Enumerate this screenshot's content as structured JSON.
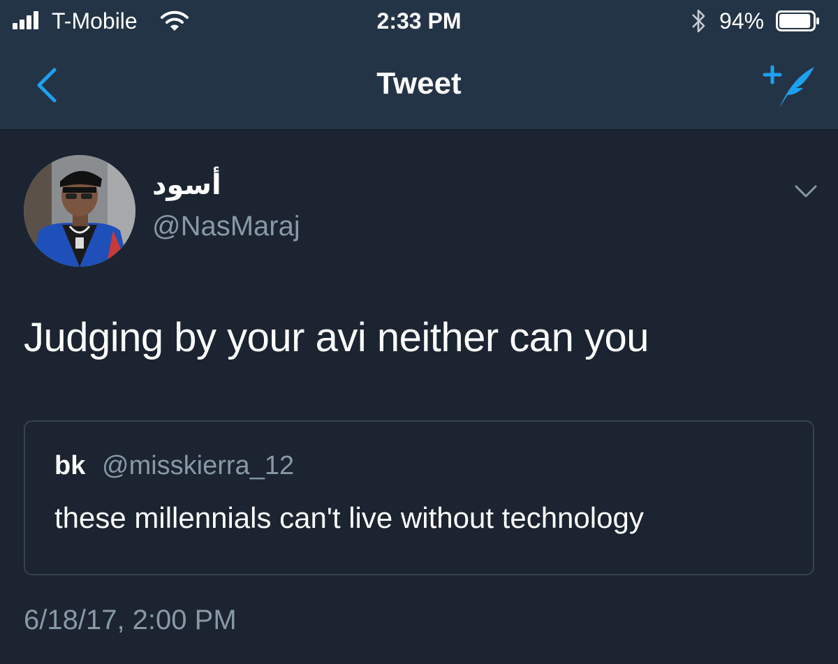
{
  "status_bar": {
    "carrier": "T-Mobile",
    "time": "2:33 PM",
    "battery_percent": "94%",
    "battery_level": 0.94,
    "signal_bars": 4
  },
  "nav": {
    "title": "Tweet",
    "back_icon": "chevron-left-icon",
    "compose_icon": "compose-tweet-icon"
  },
  "tweet": {
    "display_name": "أسود",
    "handle": "@NasMaraj",
    "text": "Judging by your avi neither can you",
    "timestamp": "6/18/17, 2:00 PM",
    "quoted": {
      "name": "bk",
      "handle": "@misskierra_12",
      "text": "these millennials can't live without technology"
    }
  },
  "colors": {
    "background": "#1b2430",
    "header": "#243447",
    "accent": "#1da1f2",
    "secondary_text": "#8899a6",
    "border": "#38444d"
  }
}
